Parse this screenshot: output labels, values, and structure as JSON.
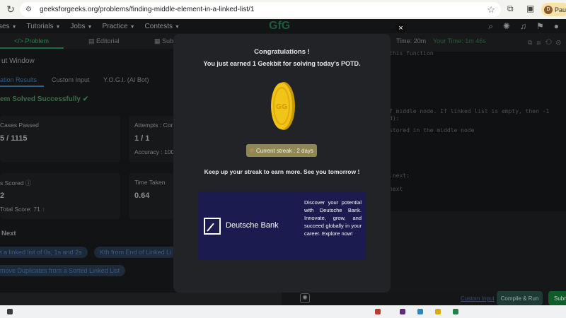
{
  "browser": {
    "url": "geeksforgeeks.org/problems/finding-middle-element-in-a-linked-list/1",
    "profile_initial": "D",
    "profile_label": "Paus"
  },
  "site_nav": {
    "items": [
      "ses",
      "Tutorials",
      "Jobs",
      "Practice",
      "Contests"
    ],
    "logo": "GfG"
  },
  "problem_tabs": {
    "problem": "Problem",
    "editorial": "Editorial",
    "submissions": "Subm",
    "timer_prefix": "Time: 20m",
    "your_time": "Your Time: 1m 46s"
  },
  "left_panel": {
    "output_window": "ut Window",
    "tabs": [
      "ation Results",
      "Custom Input",
      "Y.O.G.I. (AI Bot)"
    ],
    "solved_status": "em Solved Successfully",
    "cases_passed_label": "Cases Passed",
    "cases_passed_value": "5 / 1115",
    "attempts_label": "Attempts : Cor",
    "attempts_value": "1 / 1",
    "accuracy": "Accuracy : 100",
    "points_label": "s Scored",
    "points_value": "2",
    "total_score": "Total Score: 71",
    "time_label": "Time Taken",
    "time_value": "0.64",
    "next_label": "Next",
    "suggestions": [
      "t a linked list of 0s, 1s and 2s",
      "Kth from End of Linked Li",
      "move Duplicates from a Sorted Linked List"
    ]
  },
  "code_lines": [
    "this function",
    "f middle node. If linked list is empty, then -1",
    "d):",
    "stored in the middle node",
    ".next:",
    "next"
  ],
  "bottom_actions": {
    "custom_input": "Custom Input",
    "compile_run": "Compile & Run",
    "submit": "Subm"
  },
  "modal": {
    "title": "Congratulations !",
    "earned_text": "You just earned 1 Geekbit for solving today's POTD.",
    "streak_label": "Current streak : 2 days",
    "keep_up": "Keep up your streak to earn more. See you tomorrow !",
    "ad": {
      "brand": "Deutsche Bank",
      "text": "Discover your potential with Deutsche Bank. Innovate, grow, and succeed globally in your career. Explore now!"
    }
  }
}
